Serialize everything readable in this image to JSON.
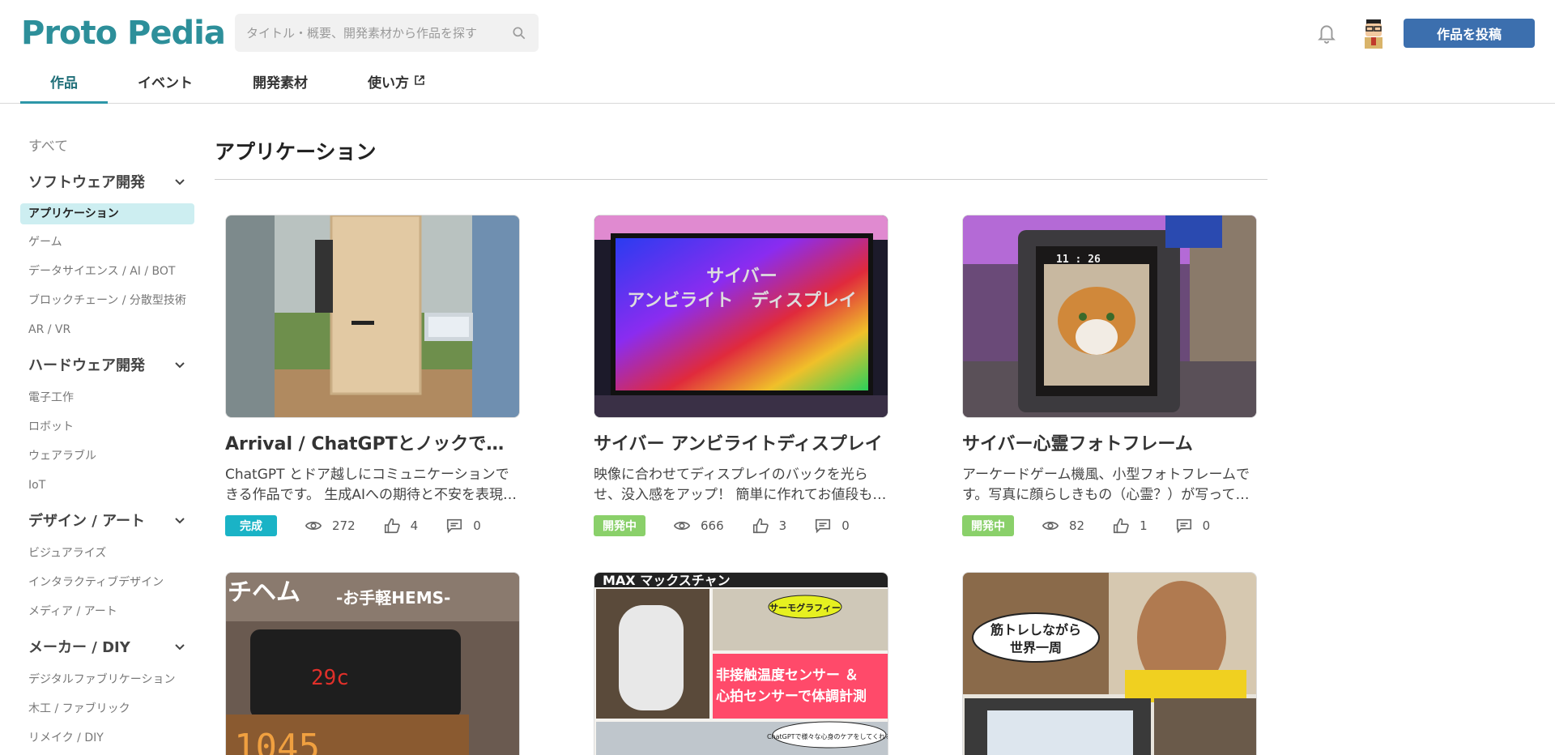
{
  "header": {
    "logo_text": "Proto Pedia",
    "search_placeholder": "タイトル・概要、開発素材から作品を探す",
    "post_button": "作品を投稿",
    "tabs": [
      {
        "label": "作品"
      },
      {
        "label": "イベント"
      },
      {
        "label": "開発素材"
      },
      {
        "label": "使い方"
      }
    ]
  },
  "sidebar": {
    "all": "すべて",
    "categories": [
      {
        "label": "ソフトウェア開発",
        "items": [
          "アプリケーション",
          "ゲーム",
          "データサイエンス / AI / BOT",
          "ブロックチェーン / 分散型技術",
          "AR / VR"
        ]
      },
      {
        "label": "ハードウェア開発",
        "items": [
          "電子工作",
          "ロボット",
          "ウェアラブル",
          "IoT"
        ]
      },
      {
        "label": "デザイン / アート",
        "items": [
          "ビジュアライズ",
          "インタラクティブデザイン",
          "メディア / アート"
        ]
      },
      {
        "label": "メーカー / DIY",
        "items": [
          "デジタルファブリケーション",
          "木工 / ファブリック",
          "リメイク / DIY"
        ]
      }
    ]
  },
  "main": {
    "title": "アプリケーション",
    "cards": [
      {
        "title": "Arrival / ChatGPTとノックでコミュニケーション",
        "desc": "ChatGPT とドア越しにコミュニケーションできる作品です。 生成AIへの期待と不安を表現しました。",
        "status": "完成",
        "status_color": "#1ab3c6",
        "views": "272",
        "likes": "4",
        "comments": "0"
      },
      {
        "title": "サイバー アンビライトディスプレイ",
        "desc": "映像に合わせてディスプレイのバックを光らせ、没入感をアップ！ 簡単に作れてお値段も手頃です。",
        "status": "開発中",
        "status_color": "#8ad06a",
        "views": "666",
        "likes": "3",
        "comments": "0",
        "thumb_text_1": "サイバー",
        "thumb_text_2": "アンビライト　ディスプレイ"
      },
      {
        "title": "サイバー心霊フォトフレーム",
        "desc": "アーケードゲーム機風、小型フォトフレームです。写真に顔らしきもの（心霊？）が写っていると…",
        "status": "開発中",
        "status_color": "#8ad06a",
        "views": "82",
        "likes": "1",
        "comments": "0",
        "thumb_text_1": "11 : 26"
      },
      {
        "title": "",
        "desc": "",
        "thumb_text_1": "チヘム",
        "thumb_text_2": "-お手軽HEMS-",
        "thumb_text_3": "29c",
        "thumb_text_4": "1045"
      },
      {
        "title": "",
        "desc": "",
        "thumb_text_1": "MAX マックスチャン",
        "thumb_text_2": "サーモグラフィー",
        "thumb_text_3": "非接触温度センサー ＆",
        "thumb_text_4": "心拍センサーで体調計測",
        "thumb_text_5": "ChatGPTで様々な心身のケアをしてくれる"
      },
      {
        "title": "",
        "desc": "",
        "thumb_text_1": "筋トレしながら",
        "thumb_text_2": "世界一周"
      }
    ]
  },
  "colors": {
    "accent": "#2d97a8",
    "button": "#3c6fae",
    "sidebar_active": "#cdeef1"
  }
}
